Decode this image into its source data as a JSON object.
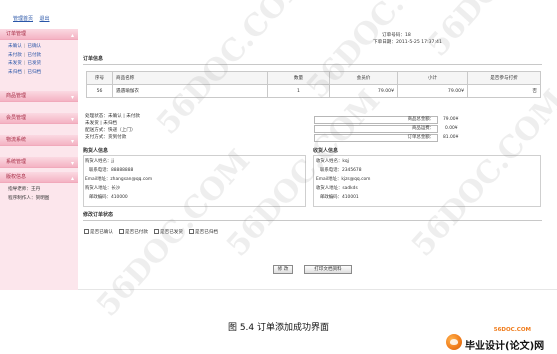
{
  "top_nav": {
    "manage_home": "管理首页",
    "logout": "退出"
  },
  "sidebar": {
    "order_section": {
      "title": "订单管理",
      "rows": [
        {
          "a": "未确认",
          "b": "已确认"
        },
        {
          "a": "未付款",
          "b": "已付款"
        },
        {
          "a": "未发货",
          "b": "已发货"
        },
        {
          "a": "未归档",
          "b": "已归档"
        }
      ]
    },
    "product_section": {
      "title": "商品管理"
    },
    "member_section": {
      "title": "会员管理"
    },
    "logistics_section": {
      "title": "物流系统"
    },
    "system_section": {
      "title": "系统管理"
    },
    "version_section": {
      "title": "版权信息",
      "guide_label": "指导老师",
      "guide_value": "王丹",
      "dev_label": "程序制作人",
      "dev_value": "贺明图"
    }
  },
  "order_meta": {
    "order_no_label": "订单号码",
    "order_no": "18",
    "time_label": "下单日期",
    "time": "2011-5-25 17:37:41"
  },
  "order_info_title": "订单信息",
  "product_table": {
    "headers": [
      "序号",
      "商品名称",
      "数量",
      "会员价",
      "小计",
      "是否参与打折"
    ],
    "rows": [
      {
        "no": "56",
        "name": "遇遇瑜伽衣",
        "qty": "1",
        "price": "79.00¥",
        "subtotal": "79.00¥",
        "discount": "否"
      }
    ]
  },
  "status_lines": {
    "order_status": "处理状态：未确认 | 未付款",
    "ship_status": "未发货 | 未归档",
    "delivery": "配送方式：快递（上门）",
    "payment": "支付方式：货到付款"
  },
  "totals": [
    {
      "label": "商品总金额：",
      "value": "79.00¥"
    },
    {
      "label": "商品运费：",
      "value": "0.00¥"
    },
    {
      "label": "订单总金额：",
      "value": "81.00¥"
    }
  ],
  "buyer": {
    "title": "购货人信息",
    "fields": [
      {
        "label": "购货人姓名：",
        "value": "jj"
      },
      {
        "label": "联系电话：",
        "value": "88888888"
      },
      {
        "label": "Email地址：",
        "value": "zhangsan@qq.com"
      },
      {
        "label": "购货人地址：",
        "value": "长沙"
      },
      {
        "label": "邮政编码：",
        "value": "410000"
      }
    ]
  },
  "receiver": {
    "title": "收货人信息",
    "fields": [
      {
        "label": "收货人姓名：",
        "value": "kqj"
      },
      {
        "label": "联系电话：",
        "value": "2345678"
      },
      {
        "label": "Email地址：",
        "value": "kjzs@qq.com"
      },
      {
        "label": "收货人地址：",
        "value": "sadkds"
      },
      {
        "label": "邮政编码：",
        "value": "410001"
      }
    ]
  },
  "modify_status": {
    "title": "修改订单状态",
    "options": [
      "是否已确认",
      "是否已付款",
      "是否已发货",
      "是否已归档"
    ]
  },
  "buttons": {
    "modify": "修 改",
    "print": "打印文档资料"
  },
  "watermark": "56DOC.COM",
  "caption": "图 5.4  订单添加成功界面",
  "logo": {
    "url": "56DOC.COM",
    "name": "毕业设计(论文)网"
  }
}
